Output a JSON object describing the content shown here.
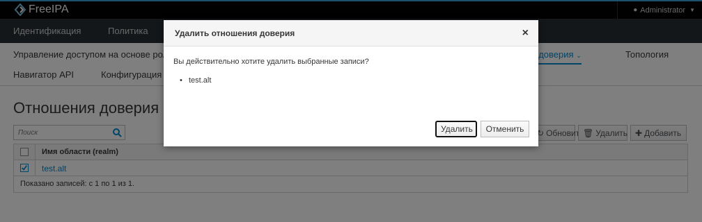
{
  "header": {
    "brand": "FreeIPA",
    "user": "Administrator"
  },
  "primary_nav": {
    "items": [
      "Идентификация",
      "Политика"
    ]
  },
  "secondary_nav": {
    "row1": [
      "Управление доступом на основе ролей",
      "Отношения доверия",
      "Топология"
    ],
    "row2": [
      "Навигатор API",
      "Конфигурация"
    ]
  },
  "page": {
    "title": "Отношения доверия",
    "search_placeholder": "Поиск",
    "toolbar": {
      "refresh": "Обновить",
      "delete": "Удалить",
      "add": "Добавить"
    },
    "table": {
      "column": "Имя области (realm)",
      "rows": [
        "test.alt"
      ],
      "footer": "Показано записей: с 1 по 1 из 1."
    }
  },
  "dialog": {
    "title": "Удалить отношения доверия",
    "close": "×",
    "question": "Вы действительно хотите удалить выбранные записи?",
    "items": [
      "test.alt"
    ],
    "buttons": {
      "confirm": "Удалить",
      "cancel": "Отменить"
    }
  },
  "colors": {
    "accent": "#0088ce",
    "topbar": "#030303",
    "nav": "#292e34"
  }
}
